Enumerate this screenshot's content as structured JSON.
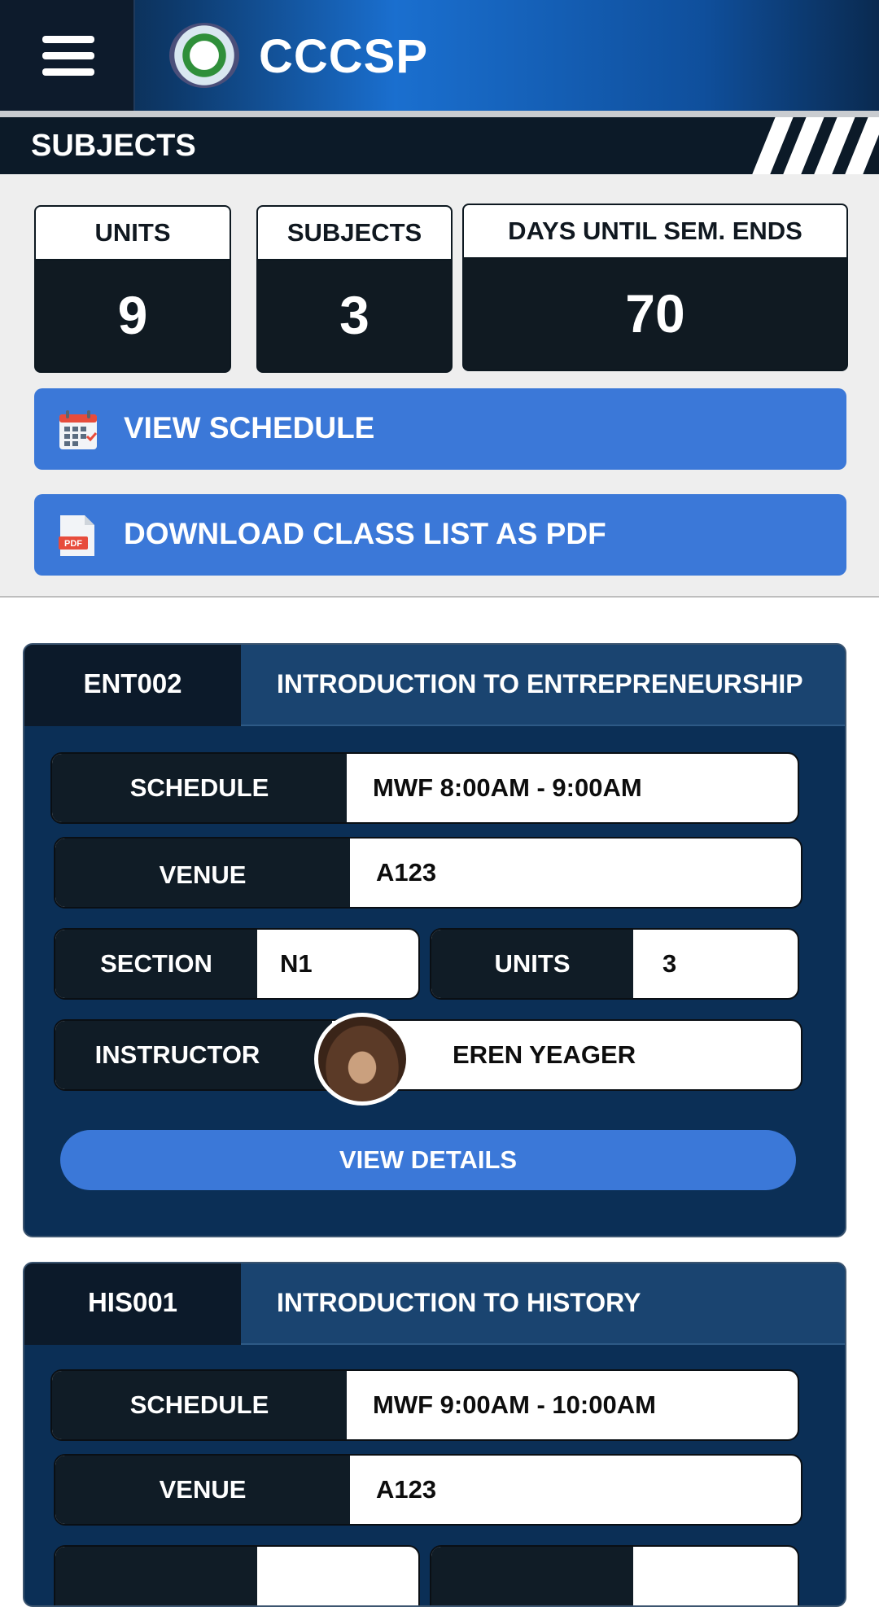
{
  "header": {
    "title": "CCCSP"
  },
  "section": {
    "title": "SUBJECTS"
  },
  "stats": [
    {
      "label": "UNITS",
      "value": "9"
    },
    {
      "label": "SUBJECTS",
      "value": "3"
    },
    {
      "label": "DAYS UNTIL SEM. ENDS",
      "value": "70"
    }
  ],
  "actions": {
    "schedule": {
      "label": "VIEW SCHEDULE",
      "icon": "calendar-icon"
    },
    "pdf": {
      "label": "DOWNLOAD CLASS LIST AS PDF",
      "icon": "pdf-icon"
    }
  },
  "subjects": [
    {
      "code": "ENT002",
      "title": "INTRODUCTION TO ENTREPRENEURSHIP",
      "schedule_label": "SCHEDULE",
      "schedule": "MWF 8:00AM - 9:00AM",
      "venue_label": "VENUE",
      "venue": "A123",
      "section_label": "SECTION",
      "section": "N1",
      "units_label": "UNITS",
      "units": "3",
      "instructor_label": "INSTRUCTOR",
      "instructor": "EREN YEAGER",
      "details_label": "VIEW DETAILS"
    },
    {
      "code": "HIS001",
      "title": "INTRODUCTION TO HISTORY",
      "schedule_label": "SCHEDULE",
      "schedule": "MWF 9:00AM - 10:00AM",
      "venue_label": "VENUE",
      "venue": "A123"
    }
  ],
  "colors": {
    "accent": "#3b78d8",
    "dark": "#0c1a28",
    "card": "#0b2f56"
  }
}
